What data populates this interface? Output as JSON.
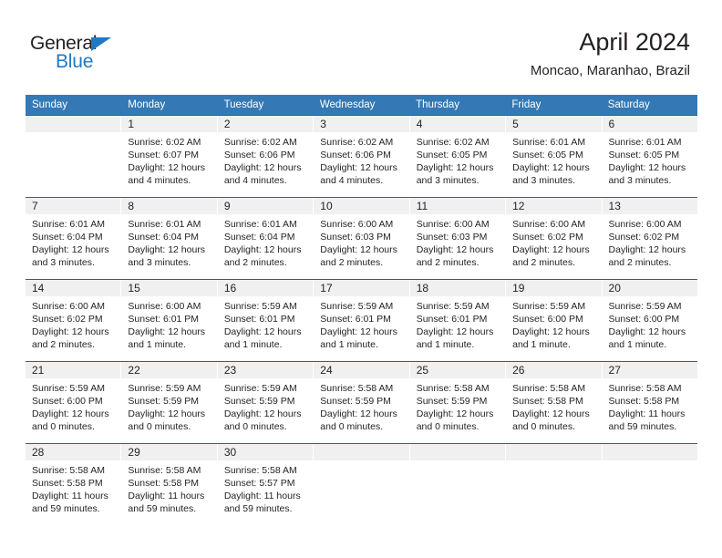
{
  "brand": {
    "name_top": "General",
    "name_bottom": "Blue",
    "triangle_color": "#1f78c1",
    "text_color": "#231f20",
    "blue_color": "#1f7ac3"
  },
  "header": {
    "title": "April 2024",
    "subtitle": "Moncao, Maranhao, Brazil"
  },
  "theme": {
    "header_bar": "#3479b5",
    "week_divider": "#2a6096",
    "daynum_band": "#f0f0f0",
    "text": "#231f20"
  },
  "calendar": {
    "weekday_headers": [
      "Sunday",
      "Monday",
      "Tuesday",
      "Wednesday",
      "Thursday",
      "Friday",
      "Saturday"
    ],
    "weeks": [
      [
        {
          "day": "",
          "sunrise": "",
          "sunset": "",
          "daylight": "",
          "empty": true
        },
        {
          "day": "1",
          "sunrise": "Sunrise: 6:02 AM",
          "sunset": "Sunset: 6:07 PM",
          "daylight": "Daylight: 12 hours and 4 minutes.",
          "empty": false
        },
        {
          "day": "2",
          "sunrise": "Sunrise: 6:02 AM",
          "sunset": "Sunset: 6:06 PM",
          "daylight": "Daylight: 12 hours and 4 minutes.",
          "empty": false
        },
        {
          "day": "3",
          "sunrise": "Sunrise: 6:02 AM",
          "sunset": "Sunset: 6:06 PM",
          "daylight": "Daylight: 12 hours and 4 minutes.",
          "empty": false
        },
        {
          "day": "4",
          "sunrise": "Sunrise: 6:02 AM",
          "sunset": "Sunset: 6:05 PM",
          "daylight": "Daylight: 12 hours and 3 minutes.",
          "empty": false
        },
        {
          "day": "5",
          "sunrise": "Sunrise: 6:01 AM",
          "sunset": "Sunset: 6:05 PM",
          "daylight": "Daylight: 12 hours and 3 minutes.",
          "empty": false
        },
        {
          "day": "6",
          "sunrise": "Sunrise: 6:01 AM",
          "sunset": "Sunset: 6:05 PM",
          "daylight": "Daylight: 12 hours and 3 minutes.",
          "empty": false
        }
      ],
      [
        {
          "day": "7",
          "sunrise": "Sunrise: 6:01 AM",
          "sunset": "Sunset: 6:04 PM",
          "daylight": "Daylight: 12 hours and 3 minutes.",
          "empty": false
        },
        {
          "day": "8",
          "sunrise": "Sunrise: 6:01 AM",
          "sunset": "Sunset: 6:04 PM",
          "daylight": "Daylight: 12 hours and 3 minutes.",
          "empty": false
        },
        {
          "day": "9",
          "sunrise": "Sunrise: 6:01 AM",
          "sunset": "Sunset: 6:04 PM",
          "daylight": "Daylight: 12 hours and 2 minutes.",
          "empty": false
        },
        {
          "day": "10",
          "sunrise": "Sunrise: 6:00 AM",
          "sunset": "Sunset: 6:03 PM",
          "daylight": "Daylight: 12 hours and 2 minutes.",
          "empty": false
        },
        {
          "day": "11",
          "sunrise": "Sunrise: 6:00 AM",
          "sunset": "Sunset: 6:03 PM",
          "daylight": "Daylight: 12 hours and 2 minutes.",
          "empty": false
        },
        {
          "day": "12",
          "sunrise": "Sunrise: 6:00 AM",
          "sunset": "Sunset: 6:02 PM",
          "daylight": "Daylight: 12 hours and 2 minutes.",
          "empty": false
        },
        {
          "day": "13",
          "sunrise": "Sunrise: 6:00 AM",
          "sunset": "Sunset: 6:02 PM",
          "daylight": "Daylight: 12 hours and 2 minutes.",
          "empty": false
        }
      ],
      [
        {
          "day": "14",
          "sunrise": "Sunrise: 6:00 AM",
          "sunset": "Sunset: 6:02 PM",
          "daylight": "Daylight: 12 hours and 2 minutes.",
          "empty": false
        },
        {
          "day": "15",
          "sunrise": "Sunrise: 6:00 AM",
          "sunset": "Sunset: 6:01 PM",
          "daylight": "Daylight: 12 hours and 1 minute.",
          "empty": false
        },
        {
          "day": "16",
          "sunrise": "Sunrise: 5:59 AM",
          "sunset": "Sunset: 6:01 PM",
          "daylight": "Daylight: 12 hours and 1 minute.",
          "empty": false
        },
        {
          "day": "17",
          "sunrise": "Sunrise: 5:59 AM",
          "sunset": "Sunset: 6:01 PM",
          "daylight": "Daylight: 12 hours and 1 minute.",
          "empty": false
        },
        {
          "day": "18",
          "sunrise": "Sunrise: 5:59 AM",
          "sunset": "Sunset: 6:01 PM",
          "daylight": "Daylight: 12 hours and 1 minute.",
          "empty": false
        },
        {
          "day": "19",
          "sunrise": "Sunrise: 5:59 AM",
          "sunset": "Sunset: 6:00 PM",
          "daylight": "Daylight: 12 hours and 1 minute.",
          "empty": false
        },
        {
          "day": "20",
          "sunrise": "Sunrise: 5:59 AM",
          "sunset": "Sunset: 6:00 PM",
          "daylight": "Daylight: 12 hours and 1 minute.",
          "empty": false
        }
      ],
      [
        {
          "day": "21",
          "sunrise": "Sunrise: 5:59 AM",
          "sunset": "Sunset: 6:00 PM",
          "daylight": "Daylight: 12 hours and 0 minutes.",
          "empty": false
        },
        {
          "day": "22",
          "sunrise": "Sunrise: 5:59 AM",
          "sunset": "Sunset: 5:59 PM",
          "daylight": "Daylight: 12 hours and 0 minutes.",
          "empty": false
        },
        {
          "day": "23",
          "sunrise": "Sunrise: 5:59 AM",
          "sunset": "Sunset: 5:59 PM",
          "daylight": "Daylight: 12 hours and 0 minutes.",
          "empty": false
        },
        {
          "day": "24",
          "sunrise": "Sunrise: 5:58 AM",
          "sunset": "Sunset: 5:59 PM",
          "daylight": "Daylight: 12 hours and 0 minutes.",
          "empty": false
        },
        {
          "day": "25",
          "sunrise": "Sunrise: 5:58 AM",
          "sunset": "Sunset: 5:59 PM",
          "daylight": "Daylight: 12 hours and 0 minutes.",
          "empty": false
        },
        {
          "day": "26",
          "sunrise": "Sunrise: 5:58 AM",
          "sunset": "Sunset: 5:58 PM",
          "daylight": "Daylight: 12 hours and 0 minutes.",
          "empty": false
        },
        {
          "day": "27",
          "sunrise": "Sunrise: 5:58 AM",
          "sunset": "Sunset: 5:58 PM",
          "daylight": "Daylight: 11 hours and 59 minutes.",
          "empty": false
        }
      ],
      [
        {
          "day": "28",
          "sunrise": "Sunrise: 5:58 AM",
          "sunset": "Sunset: 5:58 PM",
          "daylight": "Daylight: 11 hours and 59 minutes.",
          "empty": false
        },
        {
          "day": "29",
          "sunrise": "Sunrise: 5:58 AM",
          "sunset": "Sunset: 5:58 PM",
          "daylight": "Daylight: 11 hours and 59 minutes.",
          "empty": false
        },
        {
          "day": "30",
          "sunrise": "Sunrise: 5:58 AM",
          "sunset": "Sunset: 5:57 PM",
          "daylight": "Daylight: 11 hours and 59 minutes.",
          "empty": false
        },
        {
          "day": "",
          "sunrise": "",
          "sunset": "",
          "daylight": "",
          "empty": true
        },
        {
          "day": "",
          "sunrise": "",
          "sunset": "",
          "daylight": "",
          "empty": true
        },
        {
          "day": "",
          "sunrise": "",
          "sunset": "",
          "daylight": "",
          "empty": true
        },
        {
          "day": "",
          "sunrise": "",
          "sunset": "",
          "daylight": "",
          "empty": true
        }
      ]
    ]
  }
}
